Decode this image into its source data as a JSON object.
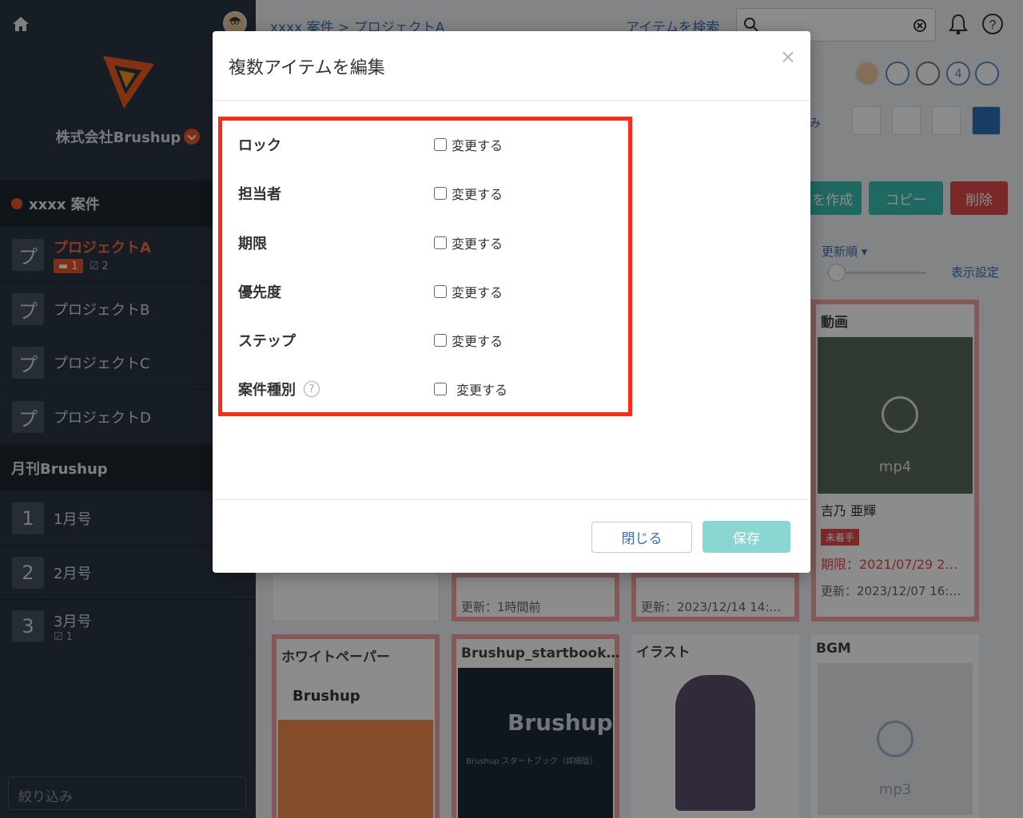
{
  "sidebar": {
    "company": "株式会社Brushup",
    "section1": "xxxx 案件",
    "projects": [
      {
        "icon": "プ",
        "label": "プロジェクトA",
        "comments": "1",
        "checks": "2"
      },
      {
        "icon": "プ",
        "label": "プロジェクトB"
      },
      {
        "icon": "プ",
        "label": "プロジェクトC"
      },
      {
        "icon": "プ",
        "label": "プロジェクトD"
      }
    ],
    "section2": "月刊Brushup",
    "issues": [
      {
        "icon": "1",
        "label": "1月号"
      },
      {
        "icon": "2",
        "label": "2月号"
      },
      {
        "icon": "3",
        "label": "3月号",
        "checks": "1"
      }
    ],
    "filter_placeholder": "絞り込み"
  },
  "header": {
    "breadcrumb": "xxxx 案件 > プロジェクトA",
    "search_link": "アイテムを検索",
    "member_count": "4"
  },
  "toolbar": {
    "create_label": "を作成",
    "copy_label": "コピー",
    "delete_label": "削除",
    "sort_label": "更新順",
    "display_settings": "表示設定",
    "search_stub": "み"
  },
  "cards": [
    {
      "title": "動画",
      "ext": "mp4",
      "assignee": "吉乃 亜輝",
      "status": "未着手",
      "deadline": "期限：2021/07/29 2…",
      "updated": "更新：2023/12/07 16:…"
    },
    {
      "updated": "更新：1時間前"
    },
    {
      "updated": "更新：2023/12/14 14:…"
    },
    {
      "title": "ホワイトペーパー",
      "logo": "Brushup"
    },
    {
      "title": "Brushup_startbook…",
      "logo": "Brushup",
      "subtitle": "Brushup スタートブック（詳細版）"
    },
    {
      "title": "イラスト"
    },
    {
      "title": "BGM",
      "ext": "mp3"
    }
  ],
  "modal": {
    "title": "複数アイテムを編集",
    "close": "×",
    "rows": [
      {
        "label": "ロック",
        "check": "変更する"
      },
      {
        "label": "担当者",
        "check": "変更する"
      },
      {
        "label": "期限",
        "check": "変更する"
      },
      {
        "label": "優先度",
        "check": "変更する"
      },
      {
        "label": "ステップ",
        "check": "変更する"
      },
      {
        "label": "案件種別",
        "check": "変更する",
        "help": "?"
      }
    ],
    "close_button": "閉じる",
    "save_button": "保存"
  },
  "colors": {
    "accent": "#e8542a",
    "sidebar": "#2b3644",
    "highlight": "#ff2a18",
    "save": "#8ad7d2",
    "copy": "#3bbfb3",
    "delete": "#e04a4a"
  }
}
